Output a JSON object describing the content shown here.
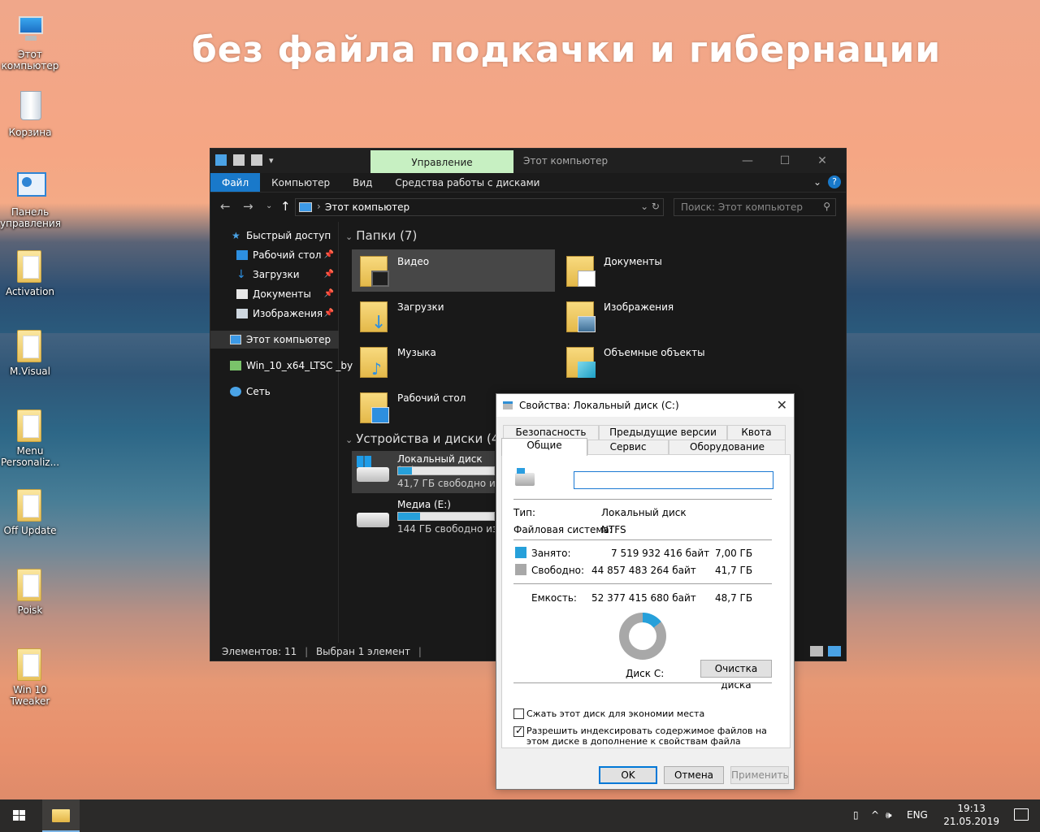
{
  "desktop": {
    "headline": "без файла подкачки и гибернации",
    "icons": [
      {
        "label": "Этот компьютер",
        "icon": "computer-icon"
      },
      {
        "label": "Корзина",
        "icon": "recycle-bin-icon"
      },
      {
        "label": "Панель управления",
        "icon": "control-panel-icon"
      },
      {
        "label": "Activation",
        "icon": "folder-icon"
      },
      {
        "label": "M.Visual",
        "icon": "folder-icon"
      },
      {
        "label": "Menu Personaliz...",
        "icon": "folder-icon"
      },
      {
        "label": "Off Update",
        "icon": "folder-icon"
      },
      {
        "label": "Poisk",
        "icon": "folder-icon"
      },
      {
        "label": "Win 10 Tweaker",
        "icon": "folder-icon"
      }
    ]
  },
  "explorer": {
    "context_tab": "Управление",
    "window_title": "Этот компьютер",
    "ribbon_tabs": [
      "Файл",
      "Компьютер",
      "Вид",
      "Средства работы с дисками"
    ],
    "address": "Этот компьютер",
    "search_placeholder": "Поиск: Этот компьютер",
    "nav": {
      "quick_access": "Быстрый доступ",
      "pinned": [
        "Рабочий стол",
        "Загрузки",
        "Документы",
        "Изображения"
      ],
      "this_pc": "Этот компьютер",
      "drive": "Win_10_x64_LTSC _by",
      "network": "Сеть"
    },
    "folders_header": "Папки (7)",
    "folders": [
      "Видео",
      "Документы",
      "Загрузки",
      "Изображения",
      "Музыка",
      "Объемные объекты",
      "Рабочий стол"
    ],
    "devices_header": "Устройства и диски (4)",
    "drives": [
      {
        "name": "Локальный диск (C:)",
        "free": "41,7 ГБ свободно из 48,7 ГБ",
        "used_fraction": 0.14
      },
      {
        "name": "Медиа (E:)",
        "free": "144 ГБ свободно из 186 ГБ",
        "used_fraction": 0.23
      }
    ],
    "status": {
      "items": "Элементов: 11",
      "selected": "Выбран 1 элемент"
    }
  },
  "properties": {
    "title": "Свойства: Локальный диск (C:)",
    "tabs_row1": [
      "Безопасность",
      "Предыдущие версии",
      "Квота"
    ],
    "tabs_row2": [
      "Общие",
      "Сервис",
      "Оборудование"
    ],
    "active_tab": "Общие",
    "name_value": "",
    "type_label": "Тип:",
    "type_value": "Локальный диск",
    "fs_label": "Файловая система:",
    "fs_value": "NTFS",
    "used_label": "Занято:",
    "used_bytes": "7 519 932 416 байт",
    "used_gb": "7,00 ГБ",
    "free_label": "Свободно:",
    "free_bytes": "44 857 483 264 байт",
    "free_gb": "41,7 ГБ",
    "capacity_label": "Емкость:",
    "capacity_bytes": "52 377 415 680 байт",
    "capacity_gb": "48,7 ГБ",
    "used_fraction": 0.144,
    "disk_label": "Диск C:",
    "cleanup_button": "Очистка диска",
    "compress_label": "Сжать этот диск для экономии места",
    "compress_checked": false,
    "index_label": "Разрешить индексировать содержимое файлов на этом диске в дополнение к свойствам файла",
    "index_checked": true,
    "ok": "OK",
    "cancel": "Отмена",
    "apply": "Применить",
    "colors": {
      "used": "#26a0da",
      "free": "#a8a8a8"
    }
  },
  "taskbar": {
    "lang": "ENG",
    "time": "19:13",
    "date": "21.05.2019"
  }
}
